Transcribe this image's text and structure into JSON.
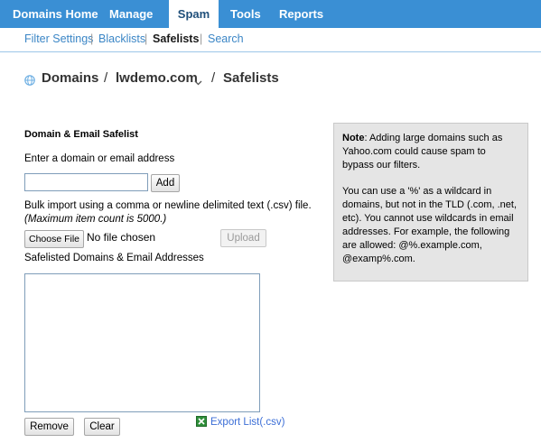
{
  "topnav": {
    "tabs": [
      {
        "label": "Domains Home",
        "active": false
      },
      {
        "label": "Manage",
        "active": false
      },
      {
        "label": "Spam",
        "active": true
      },
      {
        "label": "Tools",
        "active": false
      },
      {
        "label": "Reports",
        "active": false
      }
    ]
  },
  "subnav": {
    "items": [
      {
        "label": "Filter Settings",
        "active": false
      },
      {
        "label": "Blacklists",
        "active": false
      },
      {
        "label": "Safelists",
        "active": true
      },
      {
        "label": "Search",
        "active": false
      }
    ],
    "separator": "|"
  },
  "breadcrumb": {
    "icon": "globe-icon",
    "root": "Domains",
    "sep": "/",
    "domain": "lwdemo.com",
    "dropdown_icon": "chevron-down-icon",
    "current": "Safelists"
  },
  "form": {
    "section_title": "Domain & Email Safelist",
    "input_label": "Enter a domain or email address",
    "input_value": "",
    "add_button": "Add",
    "bulk_label": "Bulk import using a comma or newline delimited text (.csv) file.",
    "bulk_note": "(Maximum item count is 5000.)",
    "choose_file_button": "Choose File",
    "file_status": "No file chosen",
    "upload_button": "Upload",
    "list_label": "Safelisted Domains & Email Addresses",
    "list_items": [],
    "remove_button": "Remove",
    "clear_button": "Clear",
    "export_icon": "excel-icon",
    "export_link": "Export List(.csv)"
  },
  "note": {
    "heading": "Note",
    "para1": ": Adding large domains such as Yahoo.com could cause spam to bypass our filters.",
    "para2": "You can use a '%' as a wildcard in domains, but not in the TLD (.com, .net, etc). You cannot use wildcards in email addresses. For example, the following are allowed: @%.example.com, @examp%.com."
  },
  "colors": {
    "nav_bar": "#3a8fd4",
    "link": "#3b86c6",
    "note_bg": "#e5e5e5"
  }
}
